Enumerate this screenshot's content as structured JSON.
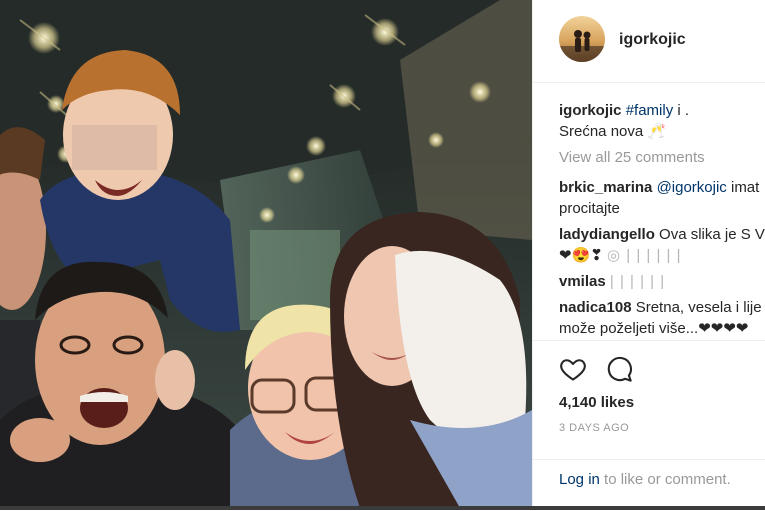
{
  "post": {
    "username": "igorkojic",
    "caption_user": "igorkojic",
    "caption_hashtag": "#family",
    "caption_rest": " i .",
    "caption_line2": "Srećna nova 🥂",
    "view_all": "View all 25 comments",
    "likes": "4,140 likes",
    "time": "3 DAYS AGO",
    "login_link": "Log in",
    "login_rest": " to like or comment."
  },
  "comments": [
    {
      "user": "brkic_marina",
      "mention": "@igorkojic",
      "text": " imat",
      "text2": "procitajte"
    },
    {
      "user": "ladydiangello",
      "text": " Ova slika je S V",
      "text2": "❤😍❣",
      "faint": "◎ | | | | | |"
    },
    {
      "user": "vmilas",
      "faint": " | | | | | |"
    },
    {
      "user": "nadica108",
      "text": " Sretna, vesela i lije",
      "text2": "može poželjeti više...❤❤❤❤"
    }
  ],
  "colors": {
    "link": "#003569",
    "secondary_text": "#999999",
    "divider": "#efefef"
  },
  "icons": [
    "heart-icon",
    "comment-icon"
  ]
}
